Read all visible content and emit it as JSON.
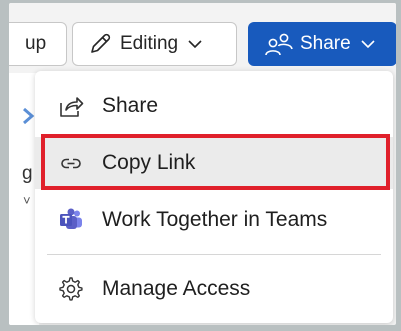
{
  "toolbar": {
    "group_partial_label": "up",
    "editing_label": "Editing",
    "share_label": "Share"
  },
  "background": {
    "partial_letter": "g",
    "partial_chevron": "˅"
  },
  "menu": {
    "items": [
      {
        "label": "Share",
        "icon": "share-arrow-icon"
      },
      {
        "label": "Copy Link",
        "icon": "link-icon",
        "highlighted": true
      },
      {
        "label": "Work Together in Teams",
        "icon": "teams-icon"
      },
      {
        "label": "Manage Access",
        "icon": "gear-icon"
      }
    ]
  },
  "colors": {
    "share_button": "#185abd",
    "highlight_border": "#e0202b",
    "teams_purple": "#5b5fc7"
  }
}
